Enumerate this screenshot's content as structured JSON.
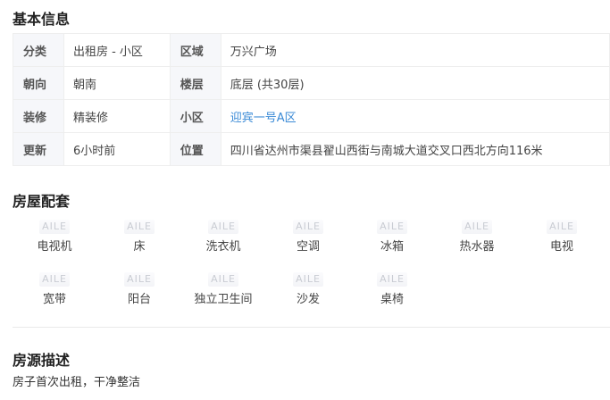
{
  "basic_info": {
    "title": "基本信息",
    "rows": [
      {
        "k1": "分类",
        "v1": "出租房 - 小区",
        "k2": "区域",
        "v2": "万兴广场"
      },
      {
        "k1": "朝向",
        "v1": "朝南",
        "k2": "楼层",
        "v2": "底层 (共30层)"
      },
      {
        "k1": "装修",
        "v1": "精装修",
        "k2": "小区",
        "v2": "迎宾一号A区"
      },
      {
        "k1": "更新",
        "v1": "6小时前",
        "k2": "位置",
        "v2": "四川省达州市渠县翟山西街与南城大道交叉口西北方向116米"
      }
    ]
  },
  "facilities": {
    "title": "房屋配套",
    "icon_placeholder": "AILE",
    "items": [
      {
        "label": "电视机",
        "icon": "tv-icon"
      },
      {
        "label": "床",
        "icon": "bed-icon"
      },
      {
        "label": "洗衣机",
        "icon": "washing-machine-icon"
      },
      {
        "label": "空调",
        "icon": "air-conditioner-icon"
      },
      {
        "label": "冰箱",
        "icon": "fridge-icon"
      },
      {
        "label": "热水器",
        "icon": "water-heater-icon"
      },
      {
        "label": "电视",
        "icon": "tv-icon"
      },
      {
        "label": "宽带",
        "icon": "broadband-icon"
      },
      {
        "label": "阳台",
        "icon": "balcony-icon"
      },
      {
        "label": "独立卫生间",
        "icon": "bathroom-icon"
      },
      {
        "label": "沙发",
        "icon": "sofa-icon"
      },
      {
        "label": "桌椅",
        "icon": "table-chair-icon"
      }
    ]
  },
  "description": {
    "title": "房源描述",
    "text": "房子首次出租，干净整洁"
  },
  "colors": {
    "link": "#3a8ad6",
    "label_bg": "#f6f7fa",
    "border": "#eeeeee"
  }
}
